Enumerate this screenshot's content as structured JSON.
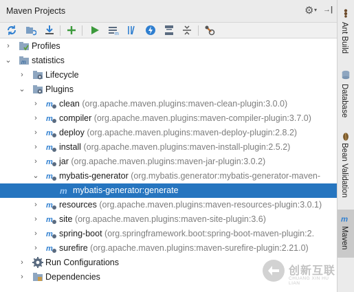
{
  "header": {
    "title": "Maven Projects"
  },
  "tree": {
    "profiles": "Profiles",
    "statistics": "statistics",
    "lifecycle": "Lifecycle",
    "plugins": "Plugins",
    "plugin_items": [
      {
        "name": "clean",
        "coord": "(org.apache.maven.plugins:maven-clean-plugin:3.0.0)"
      },
      {
        "name": "compiler",
        "coord": "(org.apache.maven.plugins:maven-compiler-plugin:3.7.0)"
      },
      {
        "name": "deploy",
        "coord": "(org.apache.maven.plugins:maven-deploy-plugin:2.8.2)"
      },
      {
        "name": "install",
        "coord": "(org.apache.maven.plugins:maven-install-plugin:2.5.2)"
      },
      {
        "name": "jar",
        "coord": "(org.apache.maven.plugins:maven-jar-plugin:3.0.2)"
      },
      {
        "name": "mybatis-generator",
        "coord": "(org.mybatis.generator:mybatis-generator-maven-"
      },
      {
        "name": "resources",
        "coord": "(org.apache.maven.plugins:maven-resources-plugin:3.0.1)"
      },
      {
        "name": "site",
        "coord": "(org.apache.maven.plugins:maven-site-plugin:3.6)"
      },
      {
        "name": "spring-boot",
        "coord": "(org.springframework.boot:spring-boot-maven-plugin:2."
      },
      {
        "name": "surefire",
        "coord": "(org.apache.maven.plugins:maven-surefire-plugin:2.21.0)"
      }
    ],
    "goal": "mybatis-generator:generate",
    "run_configurations": "Run Configurations",
    "dependencies": "Dependencies"
  },
  "right_tabs": [
    "Ant Build",
    "Database",
    "Bean Validation",
    "Maven"
  ],
  "watermark": {
    "text": "创新互联",
    "sub": "CHUANG XIN HU LIAN"
  },
  "colors": {
    "selection": "#2675bf",
    "header_bg": "#ebebeb"
  }
}
